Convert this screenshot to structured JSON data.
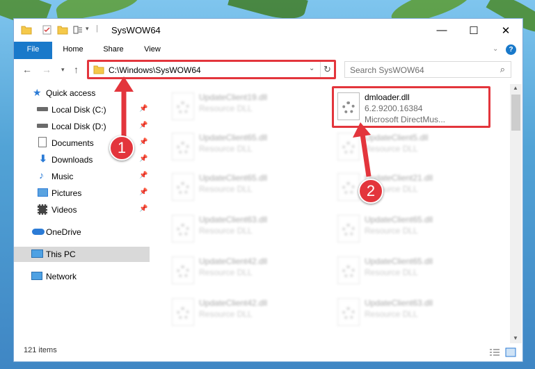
{
  "window": {
    "title": "SysWOW64",
    "controls": {
      "minimize": "—",
      "maximize": "☐",
      "close": "✕"
    }
  },
  "ribbon": {
    "tabs": [
      {
        "label": "File"
      },
      {
        "label": "Home"
      },
      {
        "label": "Share"
      },
      {
        "label": "View"
      }
    ],
    "help": "?"
  },
  "address": {
    "path": "C:\\Windows\\SysWOW64",
    "search_placeholder": "Search SysWOW64"
  },
  "sidebar": {
    "items": [
      {
        "label": "Quick access",
        "icon": "star-icon",
        "pinned": false
      },
      {
        "label": "Local Disk (C:)",
        "icon": "drive-icon",
        "pinned": true
      },
      {
        "label": "Local Disk (D:)",
        "icon": "drive-icon",
        "pinned": true
      },
      {
        "label": "Documents",
        "icon": "documents-icon",
        "pinned": true
      },
      {
        "label": "Downloads",
        "icon": "download-icon",
        "pinned": true
      },
      {
        "label": "Music",
        "icon": "music-icon",
        "pinned": true
      },
      {
        "label": "Pictures",
        "icon": "pictures-icon",
        "pinned": true
      },
      {
        "label": "Videos",
        "icon": "videos-icon",
        "pinned": true
      },
      {
        "label": "OneDrive",
        "icon": "cloud-icon",
        "pinned": false
      },
      {
        "label": "This PC",
        "icon": "computer-icon",
        "pinned": false,
        "selected": true
      },
      {
        "label": "Network",
        "icon": "network-icon",
        "pinned": false
      }
    ]
  },
  "files": {
    "left": [
      {
        "name": "UpdateClient19.dll",
        "type": "Resource DLL"
      },
      {
        "name": "UpdateClient65.dll",
        "type": "Resource DLL"
      },
      {
        "name": "UpdateClient65.dll",
        "type": "Resource DLL"
      },
      {
        "name": "UpdateClient63.dll",
        "type": "Resource DLL"
      },
      {
        "name": "UpdateClient42.dll",
        "type": "Resource DLL"
      },
      {
        "name": "UpdateClient42.dll",
        "type": "Resource DLL"
      }
    ],
    "highlighted": {
      "name": "dmloader.dll",
      "version": "6.2.9200.16384",
      "description": "Microsoft DirectMus..."
    },
    "right": [
      {
        "name": "UpdateClient5.dll",
        "type": "Resource DLL"
      },
      {
        "name": "UpdateClient21.dll",
        "type": "Resource DLL"
      },
      {
        "name": "UpdateClient65.dll",
        "type": "Resource DLL"
      },
      {
        "name": "UpdateClient65.dll",
        "type": "Resource DLL"
      },
      {
        "name": "UpdateClient63.dll",
        "type": "Resource DLL"
      }
    ]
  },
  "status": {
    "count": "121 items"
  },
  "callouts": {
    "one": "1",
    "two": "2"
  },
  "colors": {
    "accent": "#1979ca",
    "highlight": "#e3353c",
    "selected": "#d9d9d9"
  }
}
